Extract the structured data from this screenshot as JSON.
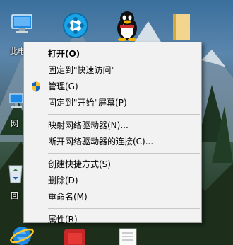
{
  "desktop": {
    "icons": [
      {
        "name": "this-pc-icon",
        "label": "此电"
      },
      {
        "name": "video-player-icon",
        "label": ""
      },
      {
        "name": "qq-penguin-icon",
        "label": ""
      },
      {
        "name": "folder-icon",
        "label": ""
      },
      {
        "name": "network-icon",
        "label": "网"
      },
      {
        "name": "recycle-bin-icon",
        "label": "回"
      },
      {
        "name": "internet-explorer-icon",
        "label": ""
      },
      {
        "name": "document-icon",
        "label": ""
      }
    ]
  },
  "context_menu": {
    "items": [
      {
        "label": "打开(O)",
        "bold": true
      },
      {
        "label": "固定到\"快速访问\""
      },
      {
        "label": "管理(G)",
        "icon": "uac-shield-icon"
      },
      {
        "label": "固定到\"开始\"屏幕(P)"
      },
      {
        "label": "映射网络驱动器(N)..."
      },
      {
        "label": "断开网络驱动器的连接(C)..."
      },
      {
        "label": "创建快捷方式(S)"
      },
      {
        "label": "删除(D)"
      },
      {
        "label": "重命名(M)"
      },
      {
        "label": "属性(R)"
      }
    ]
  },
  "colors": {
    "menu_background": "#f2f2f2",
    "menu_border": "#a0a0a0",
    "separator": "#c8c8c8"
  }
}
